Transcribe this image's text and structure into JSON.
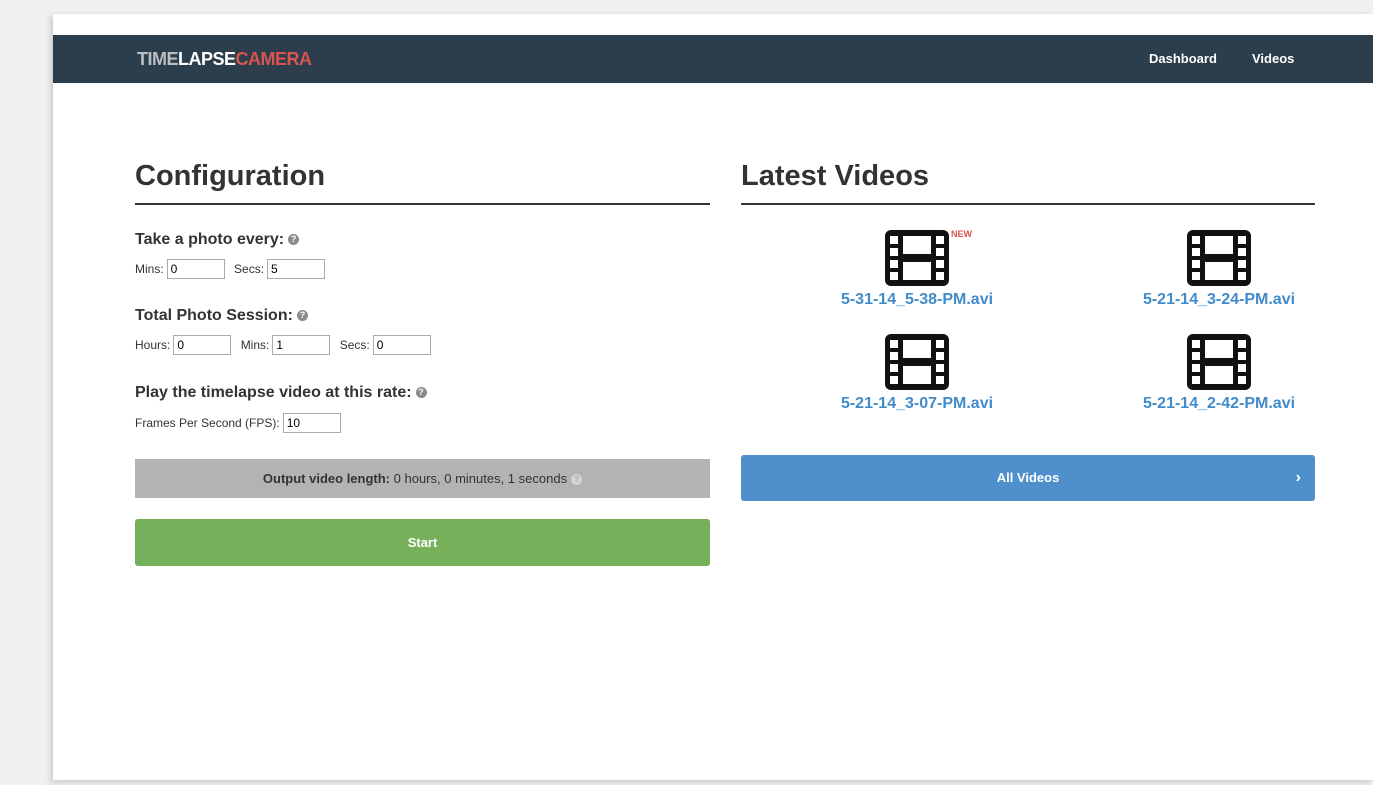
{
  "navbar": {
    "brand": {
      "part1": "TIME",
      "part2": "LAPSE",
      "part3": "CAMERA"
    },
    "links": {
      "dashboard": "Dashboard",
      "videos": "Videos"
    }
  },
  "config": {
    "title": "Configuration",
    "photo_every": {
      "label": "Take a photo every:",
      "mins_label": "Mins:",
      "mins_value": "0",
      "secs_label": "Secs:",
      "secs_value": "5"
    },
    "session": {
      "label": "Total Photo Session:",
      "hours_label": "Hours:",
      "hours_value": "0",
      "mins_label": "Mins:",
      "mins_value": "1",
      "secs_label": "Secs:",
      "secs_value": "0"
    },
    "rate": {
      "label": "Play the timelapse video at this rate:",
      "fps_label": "Frames Per Second (FPS):",
      "fps_value": "10"
    },
    "output": {
      "label": "Output video length:",
      "value": "0 hours, 0 minutes, 1 seconds"
    },
    "start_label": "Start"
  },
  "latest": {
    "title": "Latest Videos",
    "new_badge": "NEW",
    "videos": [
      {
        "name": "5-31-14_5-38-PM.avi"
      },
      {
        "name": "5-21-14_3-24-PM.avi"
      },
      {
        "name": "5-21-14_3-07-PM.avi"
      },
      {
        "name": "5-21-14_2-42-PM.avi"
      }
    ],
    "all_videos_label": "All Videos"
  },
  "icons": {
    "help": "question-circle-icon",
    "film": "film-icon",
    "chevron": "chevron-right-icon"
  },
  "colors": {
    "navbar": "#2c3e4c",
    "brand_accent": "#d9534f",
    "link": "#428bca",
    "start": "#76b05a",
    "all_videos": "#4f8fcb",
    "output_box": "#b3b3b3"
  }
}
